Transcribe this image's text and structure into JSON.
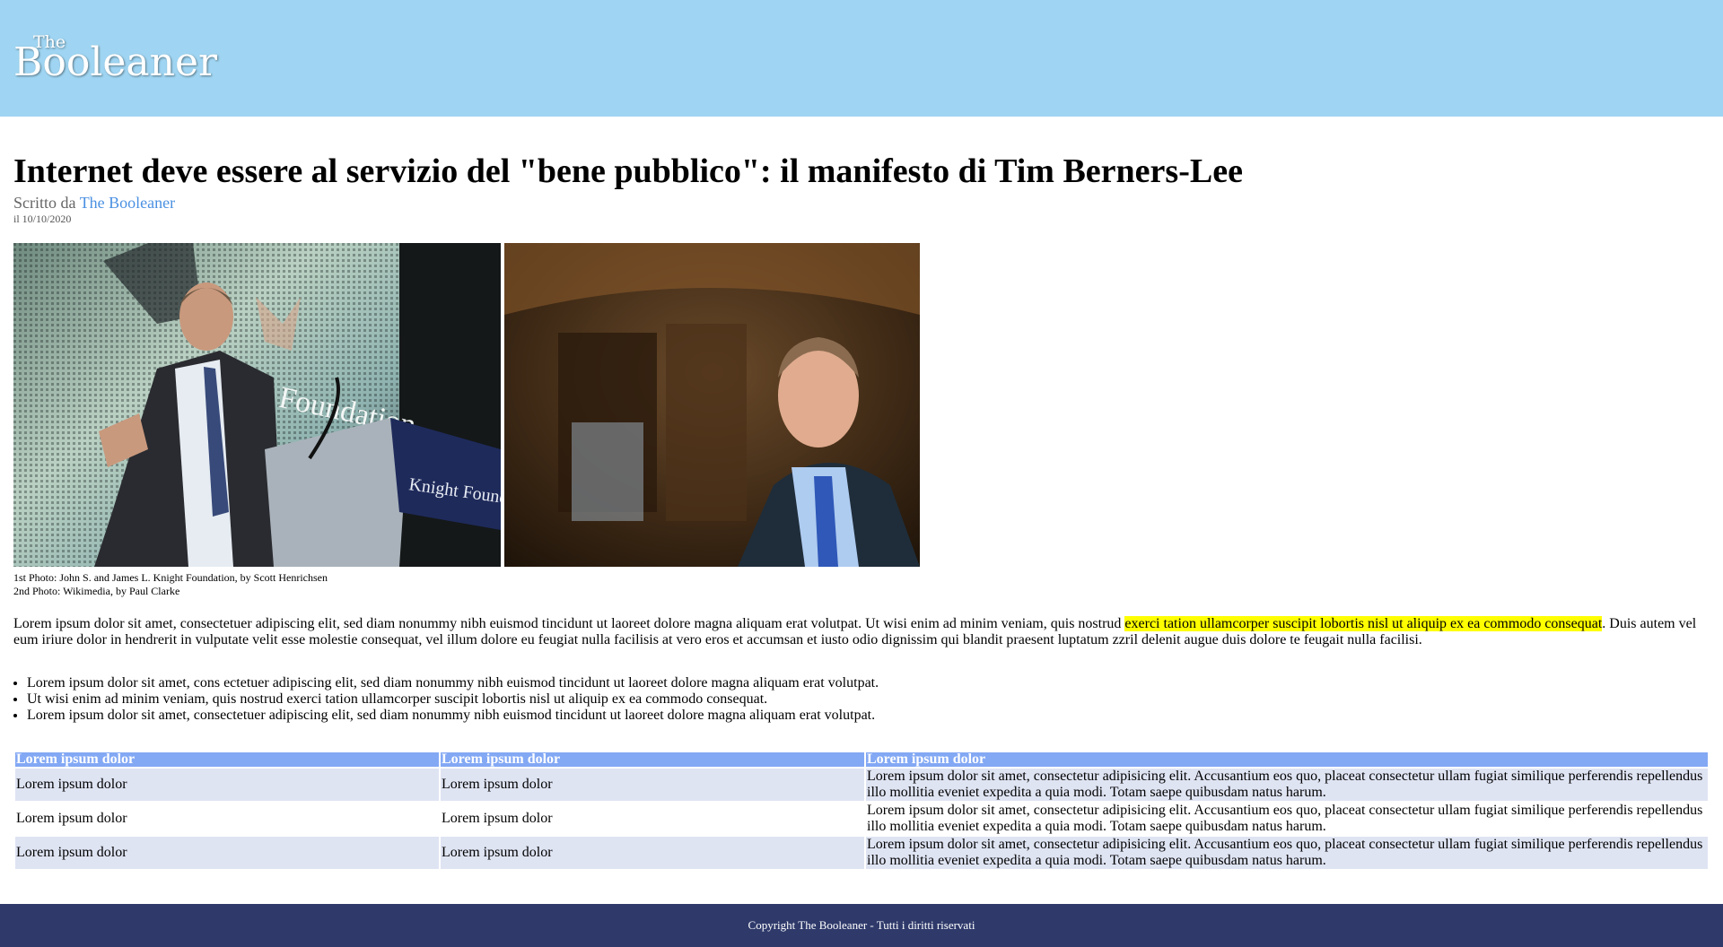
{
  "header": {
    "logo_the": "The",
    "logo_name": "Booleaner",
    "background_color": "#9fd5f2"
  },
  "article": {
    "title": "Internet deve essere al servizio del \"bene pubblico\": il manifesto di Tim Berners-Lee",
    "byline_prefix": "Scritto da",
    "byline_author": "The Booleaner",
    "date": "il 10/10/2020",
    "photos": [
      {
        "description": "photo-speaker-at-podium",
        "podium_text": "Knight Foundation",
        "backdrop_text": "ht Foundation"
      },
      {
        "description": "photo-portrait"
      }
    ],
    "caption_1": "1st Photo: John S. and James L. Knight Foundation, by Scott Henrichsen",
    "caption_2": "2nd Photo: Wikimedia, by Paul Clarke",
    "paragraph": {
      "before": "Lorem ipsum dolor sit amet, consectetuer adipiscing elit, sed diam nonummy nibh euismod tincidunt ut laoreet dolore magna aliquam erat volutpat. Ut wisi enim ad minim veniam, quis nostrud ",
      "highlight": "exerci tation ullamcorper suscipit lobortis nisl ut aliquip ex ea commodo consequat",
      "after": ". Duis autem vel eum iriure dolor in hendrerit in vulputate velit esse molestie consequat, vel illum dolore eu feugiat nulla facilisis at vero eros et accumsan et iusto odio dignissim qui blandit praesent luptatum zzril delenit augue duis dolore te feugait nulla facilisi.",
      "highlight_color": "#ffff00"
    },
    "bullets": [
      "Lorem ipsum dolor sit amet, cons ectetuer adipiscing elit, sed diam nonummy nibh euismod tincidunt ut laoreet dolore magna aliquam erat volutpat.",
      "Ut wisi enim ad minim veniam, quis nostrud exerci tation ullamcorper suscipit lobortis nisl ut aliquip ex ea commodo consequat.",
      "Lorem ipsum dolor sit amet, consectetuer adipiscing elit, sed diam nonummy nibh euismod tincidunt ut laoreet dolore magna aliquam erat volutpat."
    ]
  },
  "table": {
    "header_color": "#83a8f4",
    "headers": [
      "Lorem ipsum dolor",
      "Lorem ipsum dolor",
      "Lorem ipsum dolor"
    ],
    "rows": [
      [
        "Lorem ipsum dolor",
        "Lorem ipsum dolor",
        "Lorem ipsum dolor sit amet, consectetur adipisicing elit. Accusantium eos quo, placeat consectetur ullam fugiat similique perferendis repellendus illo mollitia eveniet expedita a quia modi. Totam saepe quibusdam natus harum."
      ],
      [
        "Lorem ipsum dolor",
        "Lorem ipsum dolor",
        "Lorem ipsum dolor sit amet, consectetur adipisicing elit. Accusantium eos quo, placeat consectetur ullam fugiat similique perferendis repellendus illo mollitia eveniet expedita a quia modi. Totam saepe quibusdam natus harum."
      ],
      [
        "Lorem ipsum dolor",
        "Lorem ipsum dolor",
        "Lorem ipsum dolor sit amet, consectetur adipisicing elit. Accusantium eos quo, placeat consectetur ullam fugiat similique perferendis repellendus illo mollitia eveniet expedita a quia modi. Totam saepe quibusdam natus harum."
      ]
    ]
  },
  "footer": {
    "text": "Copyright The Booleaner - Tutti i diritti riservati",
    "background_color": "#2f3a6b"
  }
}
